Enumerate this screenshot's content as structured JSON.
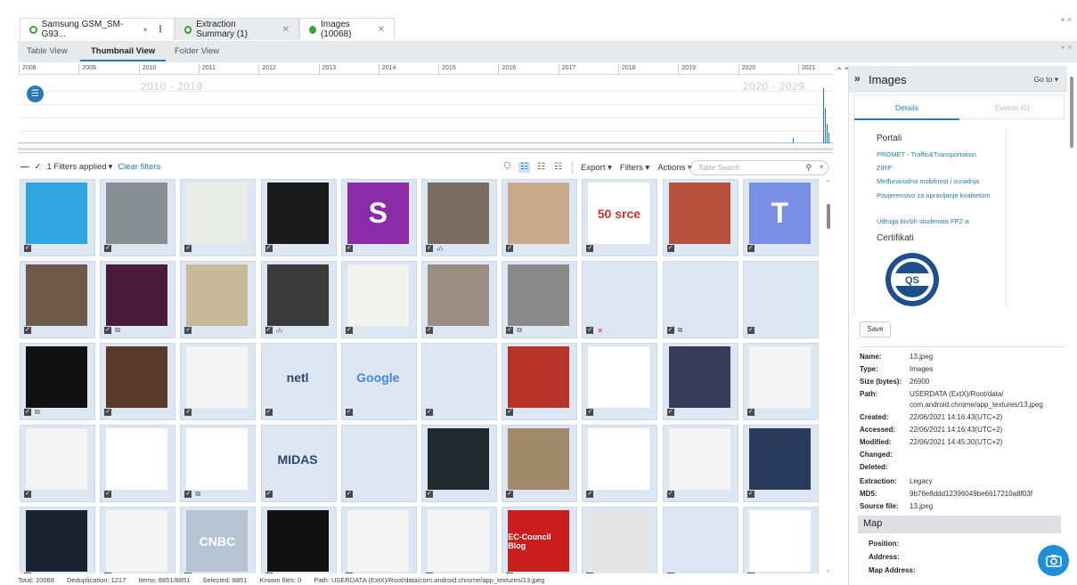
{
  "tabs": [
    {
      "label": "Samsung GSM_SM-G93...",
      "dot": "outline"
    },
    {
      "label": "Extraction Summary (1)",
      "dot": "outline"
    },
    {
      "label": "Images (10068)",
      "dot": "filled"
    }
  ],
  "views": {
    "table": "Table View",
    "thumbnail": "Thumbnail View",
    "folder": "Folder View"
  },
  "timeline": {
    "years": [
      "2008",
      "2009",
      "2010",
      "2011",
      "2012",
      "2013",
      "2014",
      "2015",
      "2016",
      "2017",
      "2018",
      "2019",
      "2020",
      "2021"
    ],
    "decade_left": "2010 - 2019",
    "decade_right": "2020 - 2029"
  },
  "filterbar": {
    "filters_applied": "1 Filters applied",
    "clear": "Clear filters",
    "export": "Export",
    "filters": "Filters",
    "actions": "Actions",
    "search_placeholder": "Table Search"
  },
  "thumbnails": [
    {
      "icon": "kids-illustration-icon",
      "bg": "#2fa6e0",
      "text": "",
      "badge": ""
    },
    {
      "icon": "man-portrait-icon",
      "bg": "#8a8f94",
      "text": "",
      "badge": ""
    },
    {
      "icon": "female-athlete-icon",
      "bg": "#e9ece8",
      "text": "",
      "badge": ""
    },
    {
      "icon": "app-window-icon",
      "bg": "#1a1a1a",
      "text": "",
      "badge": ""
    },
    {
      "icon": "letter-s-icon",
      "bg": "#8a2ba8",
      "text": "S",
      "badge": ""
    },
    {
      "icon": "train-photo-icon",
      "bg": "#7a6e64",
      "text": "",
      "badge": "</>"
    },
    {
      "icon": "woman-portrait-icon",
      "bg": "#c9a98b",
      "text": "",
      "badge": ""
    },
    {
      "icon": "srce-logo-icon",
      "bg": "#ffffff",
      "text": "50 srce",
      "badge": ""
    },
    {
      "icon": "magazines-icon",
      "bg": "#b5523d",
      "text": "",
      "badge": ""
    },
    {
      "icon": "camera-app-icon",
      "bg": "#7a8ee6",
      "text": "T",
      "badge": ""
    },
    {
      "icon": "elderly-couple-icon",
      "bg": "#6e5a4a",
      "text": "",
      "badge": ""
    },
    {
      "icon": "concert-poster-icon",
      "bg": "#4a1a3a",
      "text": "",
      "badge": "copy"
    },
    {
      "icon": "blonde-woman-icon",
      "bg": "#c8b99a",
      "text": "",
      "badge": ""
    },
    {
      "icon": "banner-woman-icon",
      "bg": "#3a3a3a",
      "text": "",
      "badge": "</>"
    },
    {
      "icon": "footballer-icon",
      "bg": "#f3f3f0",
      "text": "",
      "badge": ""
    },
    {
      "icon": "old-man-icon",
      "bg": "#9a8e84",
      "text": "",
      "badge": ""
    },
    {
      "icon": "parking-lot-icon",
      "bg": "#8a8a8a",
      "text": "",
      "badge": "copy"
    },
    {
      "icon": "blank-icon",
      "bg": "#dde6f3",
      "text": "",
      "badge": "x"
    },
    {
      "icon": "small-file-icon",
      "bg": "#dde6f3",
      "text": "",
      "badge": "copy"
    },
    {
      "icon": "phone-icon",
      "bg": "#dde6f3",
      "text": "",
      "badge": ""
    },
    {
      "icon": "exit-icon",
      "bg": "#111111",
      "text": "",
      "badge": "copy"
    },
    {
      "icon": "man-microphone-icon",
      "bg": "#5a3a2a",
      "text": "",
      "badge": ""
    },
    {
      "icon": "red-chair-icon",
      "bg": "#f5f5f5",
      "text": "",
      "badge": ""
    },
    {
      "icon": "netlify-logo-icon",
      "bg": "#dde6f3",
      "text": "netl",
      "badge": ""
    },
    {
      "icon": "google-logo-icon",
      "bg": "#dde6f3",
      "text": "Google",
      "badge": ""
    },
    {
      "icon": "loading-icon",
      "bg": "#dde6f3",
      "text": "",
      "badge": ""
    },
    {
      "icon": "red-banner-icon",
      "bg": "#b8342a",
      "text": "",
      "badge": ""
    },
    {
      "icon": "black-lines-icon",
      "bg": "#ffffff",
      "text": "",
      "badge": ""
    },
    {
      "icon": "golden-figure-icon",
      "bg": "#3a3a5a",
      "text": "",
      "badge": ""
    },
    {
      "icon": "settings-screenshot-icon",
      "bg": "#f4f4f4",
      "text": "",
      "badge": ""
    },
    {
      "icon": "app-screenshot-icon",
      "bg": "#f4f4f4",
      "text": "",
      "badge": ""
    },
    {
      "icon": "finland-flag-icon",
      "bg": "#ffffff",
      "text": "",
      "badge": ""
    },
    {
      "icon": "youtube-icon",
      "bg": "#ffffff",
      "text": "",
      "badge": "copy"
    },
    {
      "icon": "midas-logo-icon",
      "bg": "#dde6f3",
      "text": "MIDAS",
      "badge": ""
    },
    {
      "icon": "small-dot-icon",
      "bg": "#dde6f3",
      "text": "",
      "badge": ""
    },
    {
      "icon": "cyber-forensics-icon",
      "bg": "#1e2a2e",
      "text": "",
      "badge": ""
    },
    {
      "icon": "kitchen-photo-icon",
      "bg": "#a08a6a",
      "text": "",
      "badge": ""
    },
    {
      "icon": "google-play-music-icon",
      "bg": "#ffffff",
      "text": "",
      "badge": ""
    },
    {
      "icon": "chat-screenshot-icon",
      "bg": "#f4f4f4",
      "text": "",
      "badge": ""
    },
    {
      "icon": "building-photo-icon",
      "bg": "#2a3a5a",
      "text": "",
      "badge": ""
    },
    {
      "icon": "phone-lockscreen-icon",
      "bg": "#1a2530",
      "text": "",
      "badge": ""
    },
    {
      "icon": "list-screenshot-icon",
      "bg": "#f4f4f4",
      "text": "",
      "badge": ""
    },
    {
      "icon": "cnbc-logo-icon",
      "bg": "#dde6f3",
      "text": "CNBC",
      "badge": ""
    },
    {
      "icon": "black-silhouette-icon",
      "bg": "#111111",
      "text": "",
      "badge": ""
    },
    {
      "icon": "article-screenshot-icon",
      "bg": "#f4f4f4",
      "text": "",
      "badge": ""
    },
    {
      "icon": "green-app-icon",
      "bg": "#f4f4f4",
      "text": "",
      "badge": ""
    },
    {
      "icon": "ec-council-icon",
      "bg": "#c81e1e",
      "text": "EC-Council Blog",
      "badge": ""
    },
    {
      "icon": "phones-promo-icon",
      "bg": "#e4e4e4",
      "text": "",
      "badge": ""
    },
    {
      "icon": "book-cover-icon",
      "bg": "#dde6f3",
      "text": "",
      "badge": ""
    },
    {
      "icon": "handball-player-icon",
      "bg": "#ffffff",
      "text": "",
      "badge": ""
    }
  ],
  "status": {
    "total": "Total: 10068",
    "dedup": "Deduplication: 1217",
    "items": "Items: 8851/8851",
    "selected": "Selected: 8851",
    "known": "Known files: 0",
    "path": "Path: USERDATA (ExtX)/Root/data/com.android.chrome/app_textures/13.jpeg"
  },
  "panel": {
    "title": "Images",
    "goto": "Go to",
    "tab_details": "Details",
    "tab_events": "Events (0)",
    "portali": "Portali",
    "links": [
      "PROMET - Traffic&Transportation",
      "ZIRP",
      "Međunarodna mobilnost i suradnja",
      "Povjerenstvo za upravljanje kvalitetom",
      "Udruga bivših studenata FPZ-a"
    ],
    "certifikati": "Certifikati",
    "save": "Save",
    "props": [
      {
        "k": "Name:",
        "v": "13.jpeg"
      },
      {
        "k": "Type:",
        "v": "Images"
      },
      {
        "k": "Size (bytes):",
        "v": "26900"
      },
      {
        "k": "Path:",
        "v": "USERDATA (ExtX)/Root/data/"
      },
      {
        "k": "",
        "v": "com.android.chrome/app_textures/13.jpeg"
      },
      {
        "k": "Created:",
        "v": "22/06/2021 14:16:43(UTC+2)"
      },
      {
        "k": "Accessed:",
        "v": "22/06/2021 14:16:43(UTC+2)"
      },
      {
        "k": "Modified:",
        "v": "22/06/2021 14:45:30(UTC+2)"
      },
      {
        "k": "Changed:",
        "v": ""
      },
      {
        "k": "Deleted:",
        "v": ""
      },
      {
        "k": "Extraction:",
        "v": "Legacy"
      },
      {
        "k": "MD5:",
        "v": "9b76e8ddd12396049be6617210a8f03f"
      },
      {
        "k": "Source file:",
        "v": "13.jpeg"
      }
    ],
    "map": "Map",
    "map_rows": [
      "Position:",
      "Address:",
      "Map Address:"
    ]
  }
}
